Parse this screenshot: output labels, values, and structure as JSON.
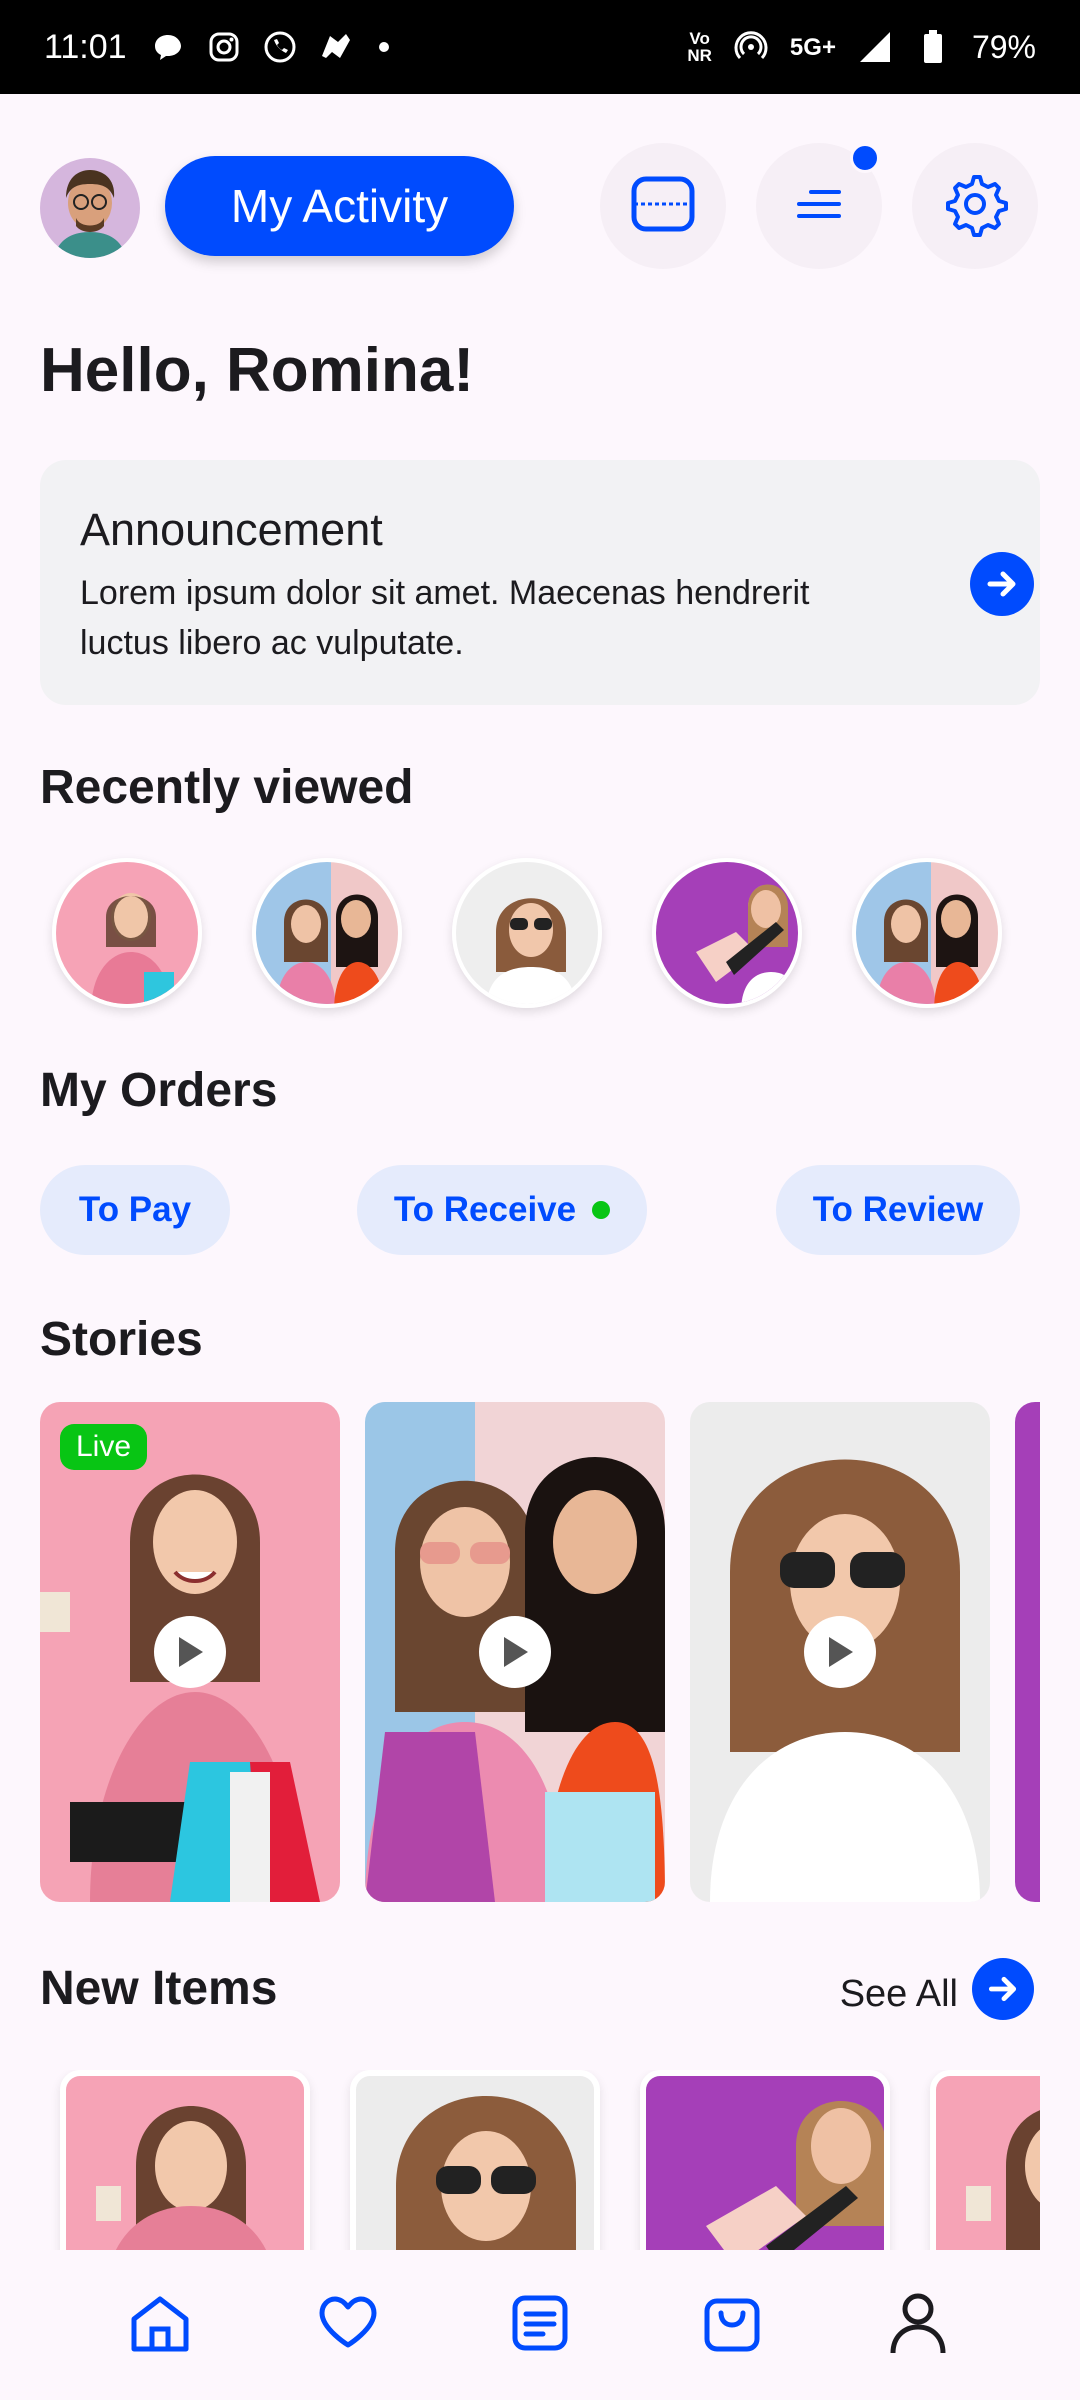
{
  "status_bar": {
    "time": "11:01",
    "network_label_top": "Vo",
    "network_label_bottom": "NR",
    "signal_label": "5G+",
    "battery": "79%"
  },
  "header": {
    "activity_label": "My Activity"
  },
  "greeting": "Hello, Romina!",
  "announcement": {
    "title": "Announcement",
    "text": "Lorem ipsum dolor sit amet. Maecenas hendrerit luctus libero ac vulputate."
  },
  "recently_viewed": {
    "title": "Recently viewed"
  },
  "orders": {
    "title": "My Orders",
    "to_pay": "To Pay",
    "to_receive": "To Receive",
    "to_review": "To Review"
  },
  "stories": {
    "title": "Stories",
    "live_label": "Live"
  },
  "new_items": {
    "title": "New Items",
    "see_all": "See All"
  },
  "colors": {
    "accent": "#004bfe",
    "live_green": "#08c514",
    "pill_bg": "#e5ebfc",
    "background": "#fdf7fd"
  },
  "icons": {
    "scan": "scan-icon",
    "menu": "menu-lines-icon",
    "settings": "gear-icon",
    "home": "home-icon",
    "favorites": "heart-icon",
    "orders": "document-icon",
    "cart": "bag-icon",
    "profile": "person-icon"
  }
}
